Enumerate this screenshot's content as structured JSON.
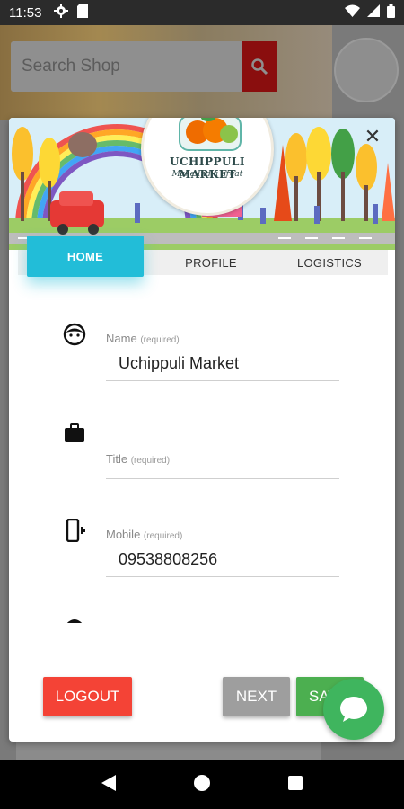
{
  "status_bar": {
    "time": "11:53",
    "left_icons": [
      "settings-icon",
      "sd-card-icon"
    ],
    "right_icons": [
      "wifi-icon",
      "signal-icon",
      "battery-icon"
    ]
  },
  "background_app": {
    "search_placeholder": "Search Shop"
  },
  "modal": {
    "logo": {
      "brand": "UCHIPPULI MARKET",
      "tagline": "Make India great"
    },
    "tabs": [
      {
        "label": "HOME",
        "active": true
      },
      {
        "label": "PROFILE",
        "active": false
      },
      {
        "label": "LOGISTICS",
        "active": false
      }
    ],
    "fields": [
      {
        "icon": "face-icon",
        "label": "Name",
        "hint": "(required)",
        "value": "Uchippuli Market"
      },
      {
        "icon": "briefcase-icon",
        "label": "Title",
        "hint": "(required)",
        "value": ""
      },
      {
        "icon": "phone-vibrate-icon",
        "label": "Mobile",
        "hint": "(required)",
        "value": "09538808256"
      }
    ],
    "buttons": {
      "logout": "LOGOUT",
      "next": "NEXT",
      "save": "SAVE"
    }
  },
  "colors": {
    "accent": "#22bdd8",
    "logout": "#f44336",
    "next": "#9e9e9e",
    "save": "#4caf50",
    "chat": "#3fb55e"
  }
}
